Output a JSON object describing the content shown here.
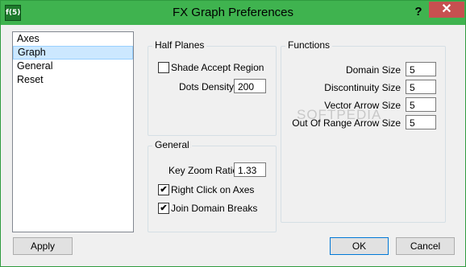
{
  "window": {
    "title": "FX Graph Preferences",
    "app_icon": "f(5)",
    "help_label": "?",
    "close_label": "✕",
    "accent": "#3fb34f"
  },
  "sidebar": {
    "items": [
      {
        "label": "Axes",
        "selected": false
      },
      {
        "label": "Graph",
        "selected": true
      },
      {
        "label": "General",
        "selected": false
      },
      {
        "label": "Reset",
        "selected": false
      }
    ]
  },
  "half_planes": {
    "title": "Half Planes",
    "shade_accept_region": {
      "label": "Shade Accept Region",
      "checked": false
    },
    "dots_density": {
      "label": "Dots Density",
      "value": "200"
    }
  },
  "general": {
    "title": "General",
    "key_zoom_ratio": {
      "label": "Key Zoom Ratio",
      "value": "1.33"
    },
    "right_click_on_axes": {
      "label": "Right Click on Axes",
      "checked": true,
      "mark": "✔"
    },
    "join_domain_breaks": {
      "label": "Join Domain Breaks",
      "checked": true,
      "mark": "✔"
    }
  },
  "functions": {
    "title": "Functions",
    "domain_size": {
      "label": "Domain Size",
      "value": "5"
    },
    "discontinuity_size": {
      "label": "Discontinuity Size",
      "value": "5"
    },
    "vector_arrow_size": {
      "label": "Vector Arrow Size",
      "value": "5"
    },
    "out_of_range_arrow_size": {
      "label": "Out Of Range Arrow Size",
      "value": "5"
    }
  },
  "buttons": {
    "apply": "Apply",
    "ok": "OK",
    "cancel": "Cancel"
  },
  "watermark": "SOFTPEDIA"
}
